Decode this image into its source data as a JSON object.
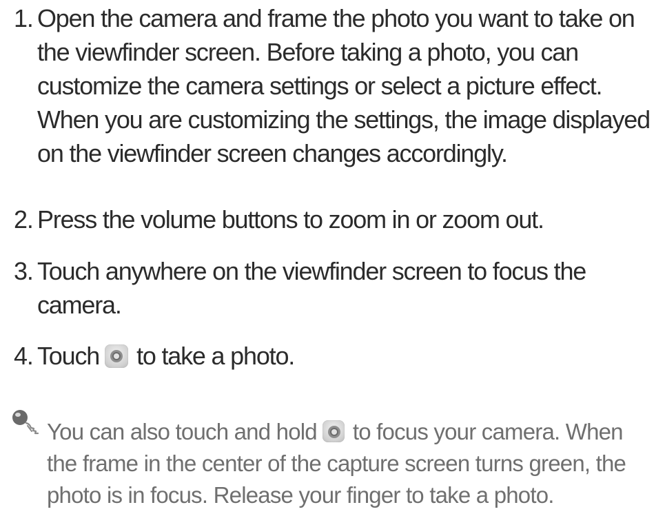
{
  "steps": [
    {
      "number": "1.",
      "lines": [
        "Open the camera and frame the photo you want to take on",
        "the viewfinder screen. Before taking a photo, you can",
        "customize the camera settings or select a picture effect.",
        "When you are customizing the settings, the image displayed",
        "on the viewfinder screen changes accordingly."
      ]
    },
    {
      "number": "2.",
      "lines": [
        "Press the volume buttons to zoom in or zoom out."
      ]
    },
    {
      "number": "3.",
      "lines": [
        "Touch anywhere on the viewfinder screen to focus the",
        "camera."
      ]
    },
    {
      "number": "4.",
      "before_icon": "Touch",
      "icon": "shutter-icon",
      "after_icon": "to take a photo."
    }
  ],
  "tip": {
    "icon": "tip-icon",
    "line1_before_icon": "You can also touch and hold",
    "line1_icon": "shutter-icon",
    "line1_after_icon": "to focus your camera. When",
    "lines": [
      "the frame in the center of the capture screen turns green, the",
      "photo is in focus. Release your finger to take a photo."
    ]
  }
}
